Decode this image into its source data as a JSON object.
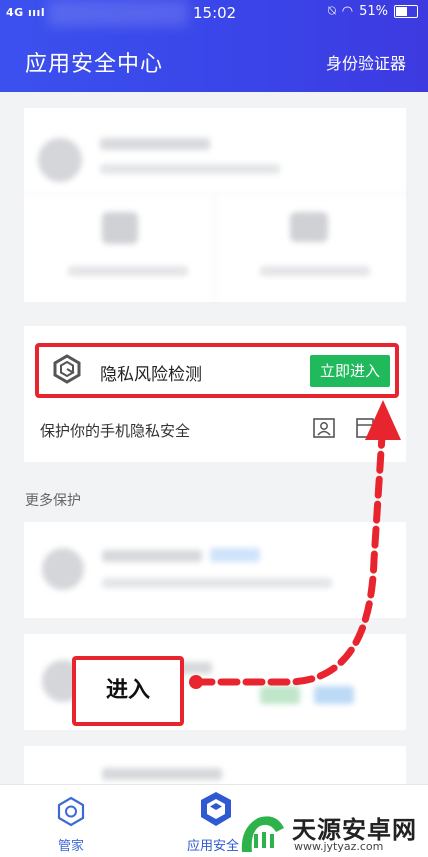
{
  "status_bar": {
    "network": "4G",
    "time": "15:02",
    "battery": "51%"
  },
  "header": {
    "title": "应用安全中心",
    "authenticator": "身份验证器"
  },
  "privacy": {
    "title": "隐私风险检测",
    "button": "立即进入",
    "subtitle": "保护你的手机隐私安全"
  },
  "more_section": {
    "label": "更多保护"
  },
  "annotation": {
    "enter": "进入",
    "color": "#e8252f"
  },
  "bottom_nav": {
    "items": [
      {
        "label": "管家"
      },
      {
        "label": "应用安全"
      }
    ]
  },
  "watermark": {
    "title": "天源安卓网",
    "url": "www.jytyaz.com"
  },
  "colors": {
    "header": "#3a44e8",
    "accent_green": "#20b95b"
  }
}
